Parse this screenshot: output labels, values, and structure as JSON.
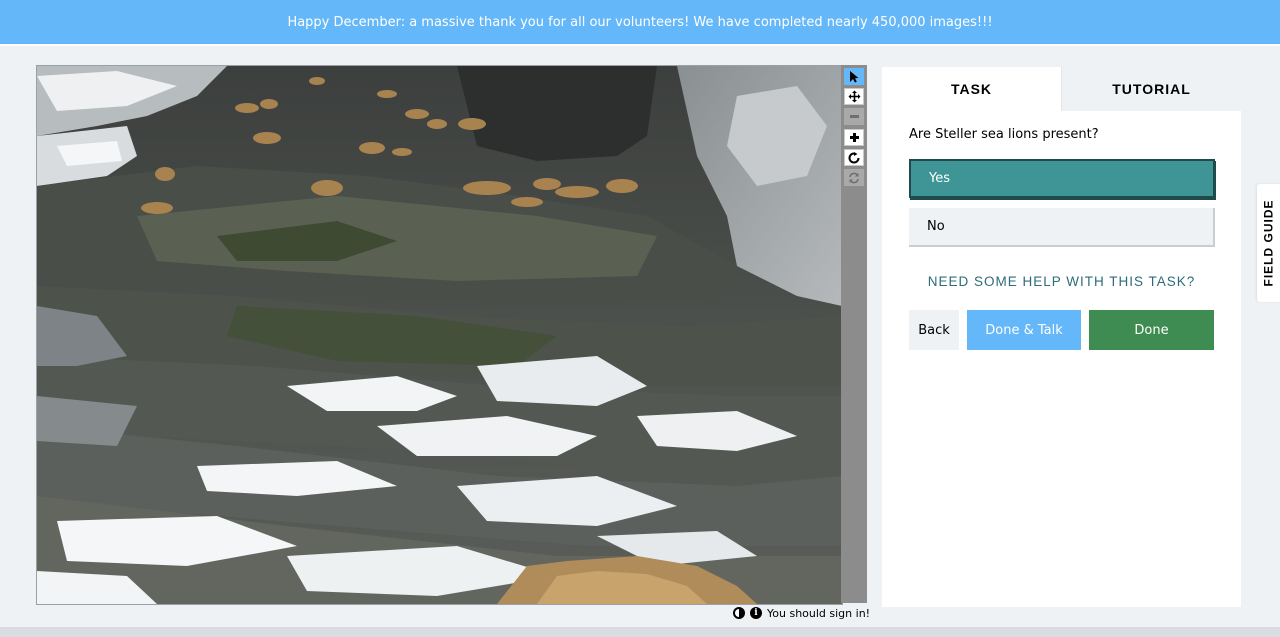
{
  "banner": {
    "message": "Happy December: a massive thank you for all our volunteers! We have completed nearly 450,000 images!!!"
  },
  "viewer": {
    "tools": [
      {
        "name": "pointer-icon",
        "state": "active"
      },
      {
        "name": "move-icon",
        "state": "normal"
      },
      {
        "name": "zoom-out-icon",
        "state": "disabled"
      },
      {
        "name": "zoom-in-icon",
        "state": "normal"
      },
      {
        "name": "rotate-icon",
        "state": "normal"
      },
      {
        "name": "reset-icon",
        "state": "disabled"
      }
    ],
    "footer": {
      "info_glyph": "i",
      "sign_in_text": "You should sign in!"
    }
  },
  "panel": {
    "tabs": {
      "task": "TASK",
      "tutorial": "TUTORIAL"
    },
    "question": "Are Steller sea lions present?",
    "answers": {
      "yes": "Yes",
      "no": "No"
    },
    "help_link": "NEED SOME HELP WITH THIS TASK?",
    "buttons": {
      "back": "Back",
      "done_talk": "Done & Talk",
      "done": "Done"
    }
  },
  "field_guide": {
    "label": "FIELD GUIDE"
  },
  "colors": {
    "banner": "#64b7f8",
    "selected_answer": "#3f9596",
    "done": "#3e8c52",
    "done_talk": "#64b7f8",
    "help_link": "#2d6c78"
  }
}
